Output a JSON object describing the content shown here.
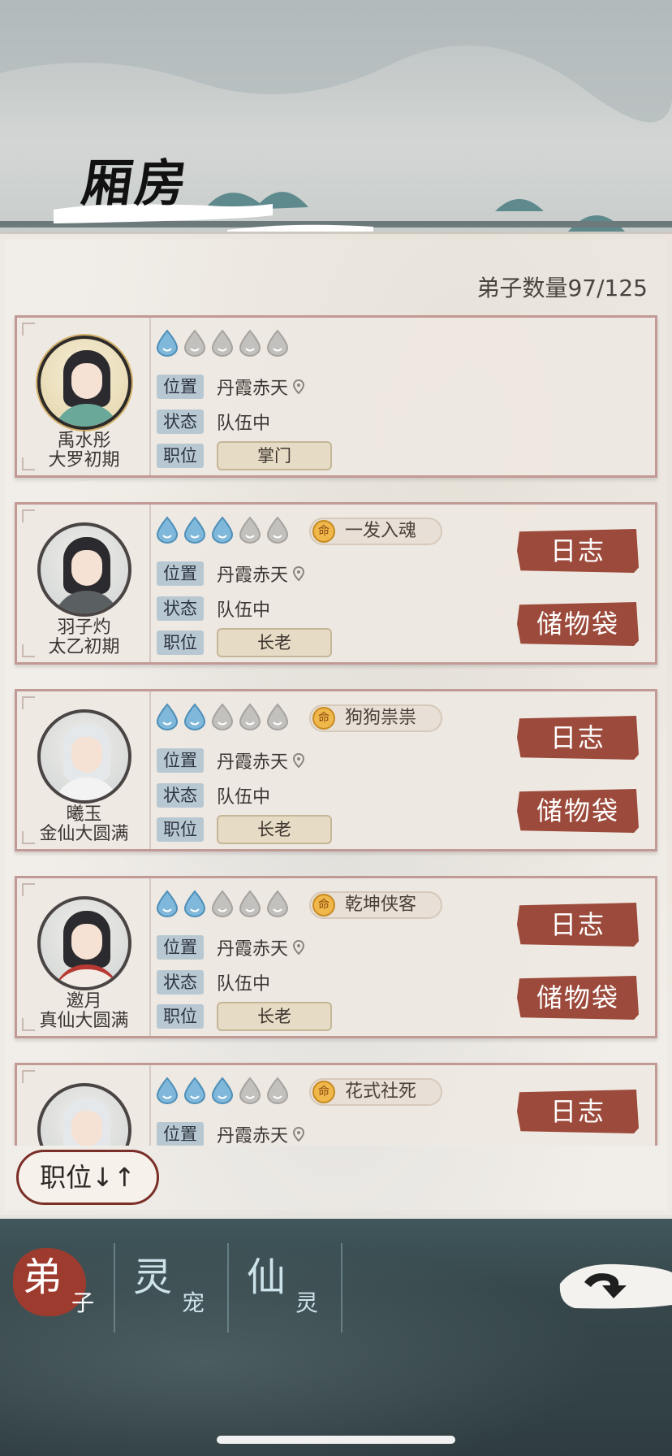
{
  "title": "厢房",
  "disciple_count": "弟子数量97/125",
  "labels": {
    "location": "位置",
    "status": "状态",
    "position": "职位"
  },
  "buttons": {
    "log": "日志",
    "storage": "储物袋"
  },
  "sort_button": "职位↓↑",
  "tabs": [
    {
      "big": "弟",
      "small": "子",
      "active": true
    },
    {
      "big": "灵",
      "small": "宠",
      "active": false
    },
    {
      "big": "仙",
      "small": "灵",
      "active": false
    }
  ],
  "disciples": [
    {
      "name": "禹水彤",
      "realm": "大罗初期",
      "drops_filled": 1,
      "trait": "",
      "location": "丹霞赤天",
      "status": "队伍中",
      "position": "掌门"
    },
    {
      "name": "羽子灼",
      "realm": "太乙初期",
      "drops_filled": 3,
      "trait": "一发入魂",
      "location": "丹霞赤天",
      "status": "队伍中",
      "position": "长老"
    },
    {
      "name": "曦玉",
      "realm": "金仙大圆满",
      "drops_filled": 2,
      "trait": "狗狗祟祟",
      "location": "丹霞赤天",
      "status": "队伍中",
      "position": "长老"
    },
    {
      "name": "邀月",
      "realm": "真仙大圆满",
      "drops_filled": 2,
      "trait": "乾坤侠客",
      "location": "丹霞赤天",
      "status": "队伍中",
      "position": "长老"
    },
    {
      "name": "",
      "realm": "",
      "drops_filled": 3,
      "trait": "花式社死",
      "location": "丹霞赤天",
      "status": "",
      "position": ""
    }
  ],
  "icons": {
    "drop": "water-drop-icon",
    "trait_badge": "fate-badge-icon",
    "pin": "location-pin-icon",
    "back": "back-arrow-icon"
  },
  "colors": {
    "accent_red": "#9c4a3b",
    "drop_blue": "#7fb8da",
    "drop_grey": "#c3c1be"
  }
}
